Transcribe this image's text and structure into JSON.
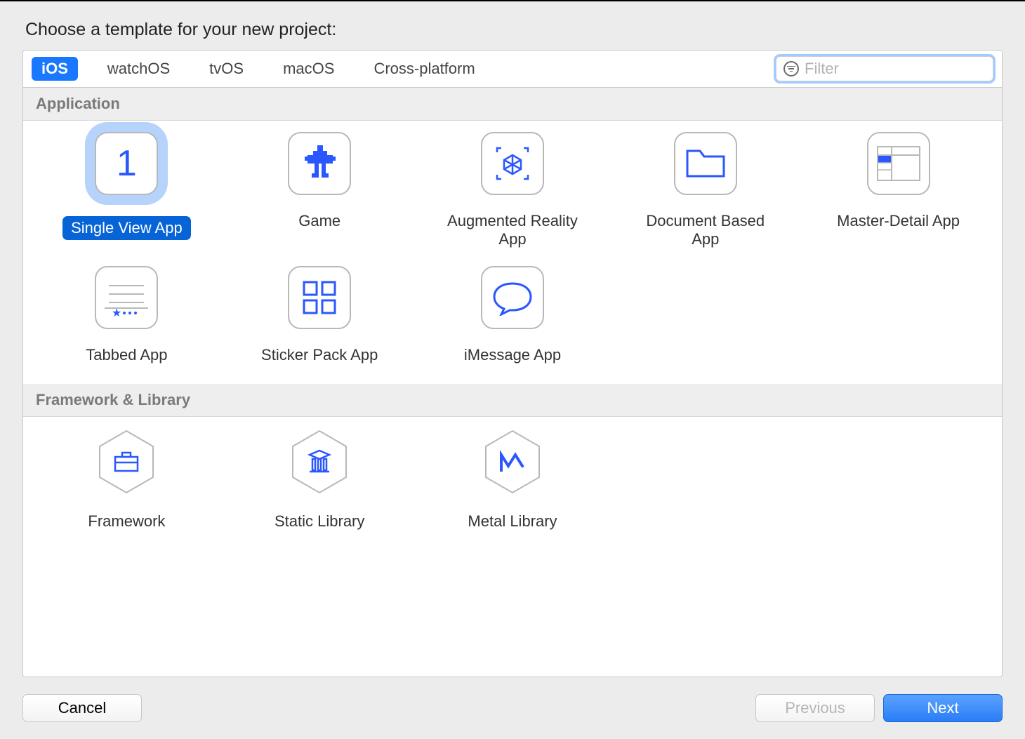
{
  "prompt": "Choose a template for your new project:",
  "tabs": [
    "iOS",
    "watchOS",
    "tvOS",
    "macOS",
    "Cross-platform"
  ],
  "selected_tab": 0,
  "filter": {
    "placeholder": "Filter",
    "value": ""
  },
  "sections": [
    {
      "title": "Application",
      "templates": [
        {
          "label": "Single View App",
          "selected": true
        },
        {
          "label": "Game"
        },
        {
          "label": "Augmented Reality App"
        },
        {
          "label": "Document Based App"
        },
        {
          "label": "Master-Detail App"
        },
        {
          "label": "Tabbed App"
        },
        {
          "label": "Sticker Pack App"
        },
        {
          "label": "iMessage App"
        }
      ]
    },
    {
      "title": "Framework & Library",
      "templates": [
        {
          "label": "Framework"
        },
        {
          "label": "Static Library"
        },
        {
          "label": "Metal Library"
        }
      ]
    }
  ],
  "buttons": {
    "cancel": "Cancel",
    "previous": "Previous",
    "next": "Next"
  }
}
